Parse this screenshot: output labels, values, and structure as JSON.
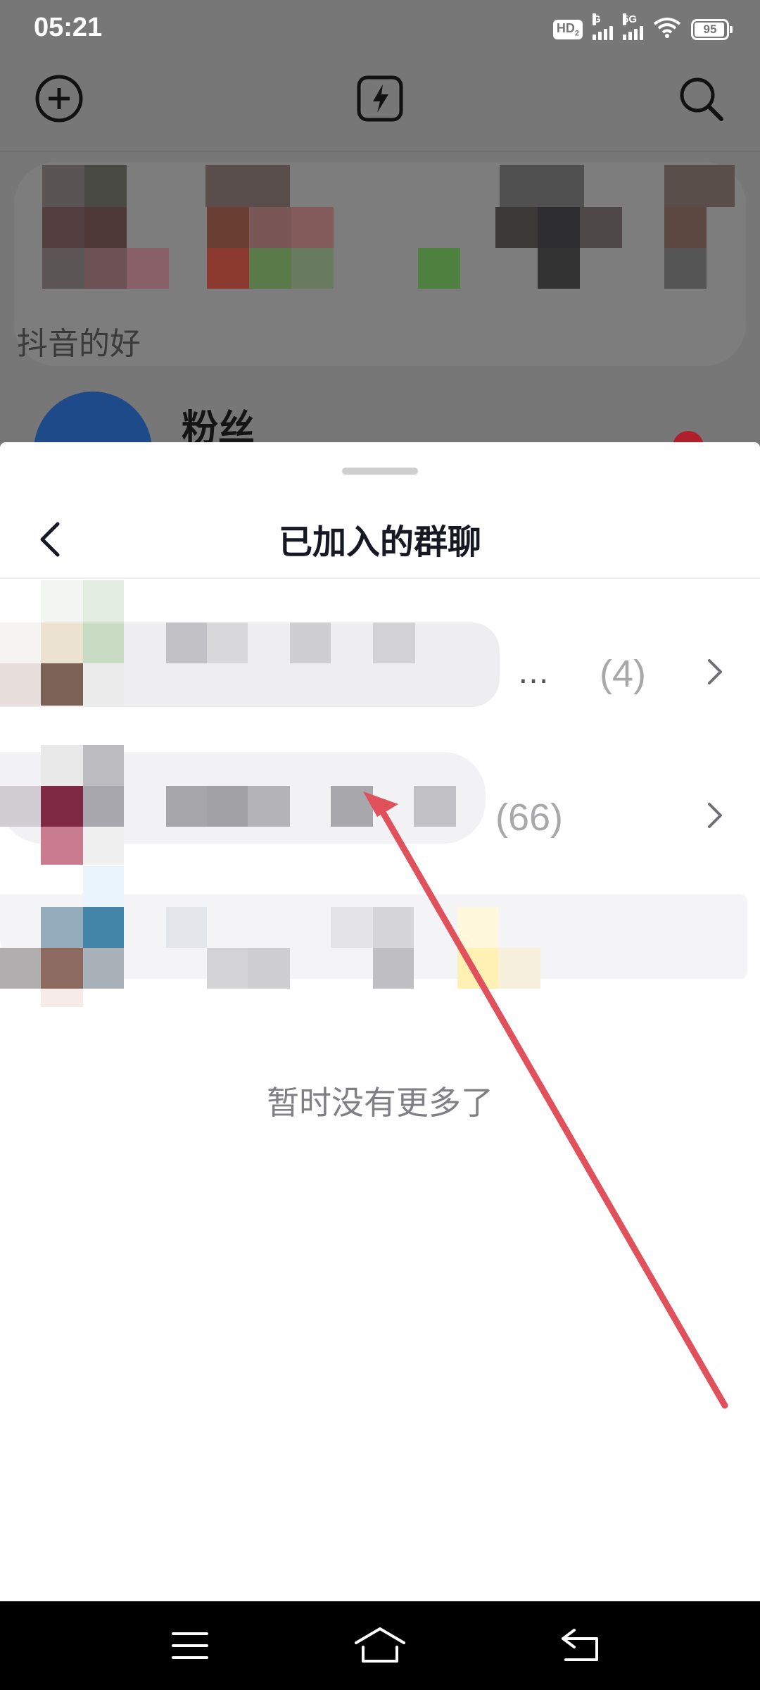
{
  "status_bar": {
    "time": "05:21",
    "hd_label": "HD",
    "hd_sub": "2",
    "signal1_label": "G",
    "signal2_label": "5G",
    "battery_level": 95,
    "battery_text": "95",
    "icons": [
      "hd-voice-icon",
      "signal-icon",
      "signal-5g-icon",
      "wifi-icon",
      "battery-icon"
    ]
  },
  "background": {
    "nav_icons": [
      "add-circle-icon",
      "flash-icon",
      "search-icon"
    ],
    "section_label": "抖音的好",
    "fans_label": "粉丝"
  },
  "sheet": {
    "title": "已加入的群聊",
    "back_icon": "chevron-left-icon",
    "groups": [
      {
        "ellipsis": "…",
        "count": "(4)"
      },
      {
        "count": "(66)"
      },
      {}
    ],
    "footer_text": "暂时没有更多了"
  },
  "annotation": {
    "color": "#e0515b"
  },
  "system_nav": {
    "icons": [
      "menu-icon",
      "home-icon",
      "back-icon"
    ]
  }
}
